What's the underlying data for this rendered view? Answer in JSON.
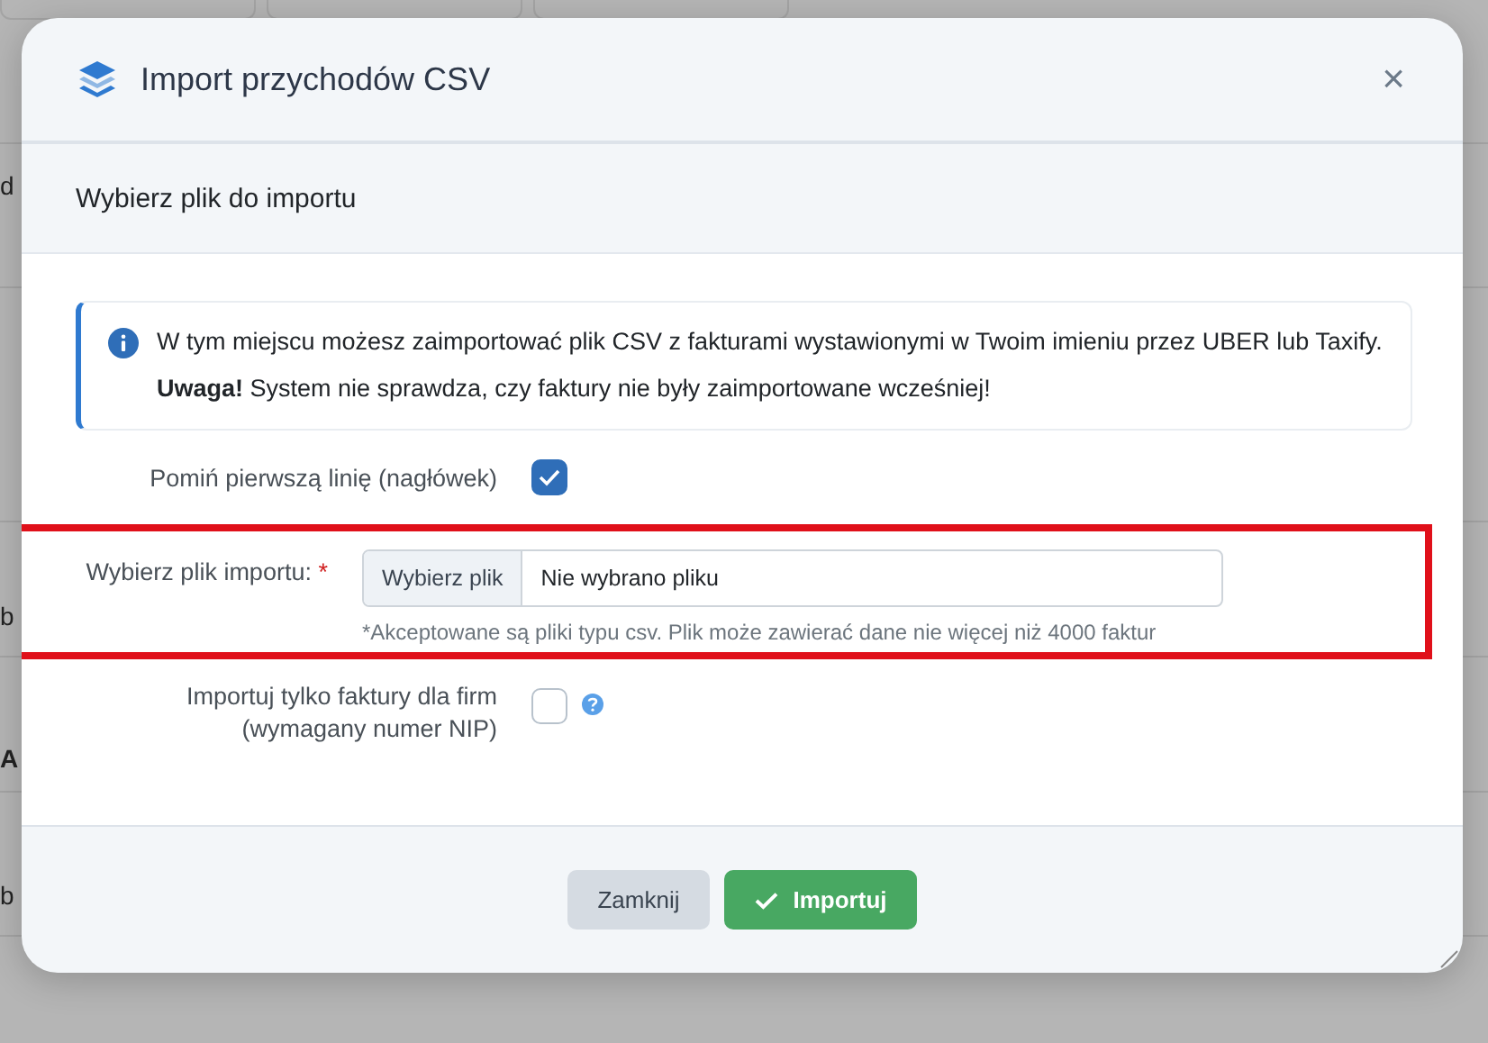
{
  "background": {
    "fragments": [
      "d",
      "b",
      "A",
      "b"
    ]
  },
  "dialog": {
    "title": "Import przychodów CSV",
    "close": "×",
    "section_title": "Wybierz plik do importu",
    "info": {
      "text": "W tym miejscu możesz zaimportować plik CSV z fakturami wystawionymi w Twoim imieniu przez UBER lub Taxify.",
      "warning": "**Uwaga!** System nie sprawdza, czy faktury nie były zaimportowane wcześniej!"
    },
    "fields": [
      {
        "kind": "checkbox",
        "label": "Pomiń pierwszą linię (nagłówek)",
        "checked": true,
        "help": false
      },
      {
        "kind": "file",
        "label": "Wybierz plik importu:",
        "required_mark": "*",
        "button": "Wybierz plik",
        "value": "Nie wybrano pliku",
        "hint": "*Akceptowane są pliki typu csv. Plik może zawierać dane nie więcej niż 4000 faktur",
        "highlighted": true
      },
      {
        "kind": "checkbox",
        "label": "Importuj tylko faktury dla firm (wymagany numer NIP)",
        "checked": false,
        "help": true
      }
    ],
    "buttons": [
      {
        "kind": "secondary",
        "label": "Zamknij"
      },
      {
        "kind": "primary",
        "label": "Importuj"
      }
    ]
  }
}
